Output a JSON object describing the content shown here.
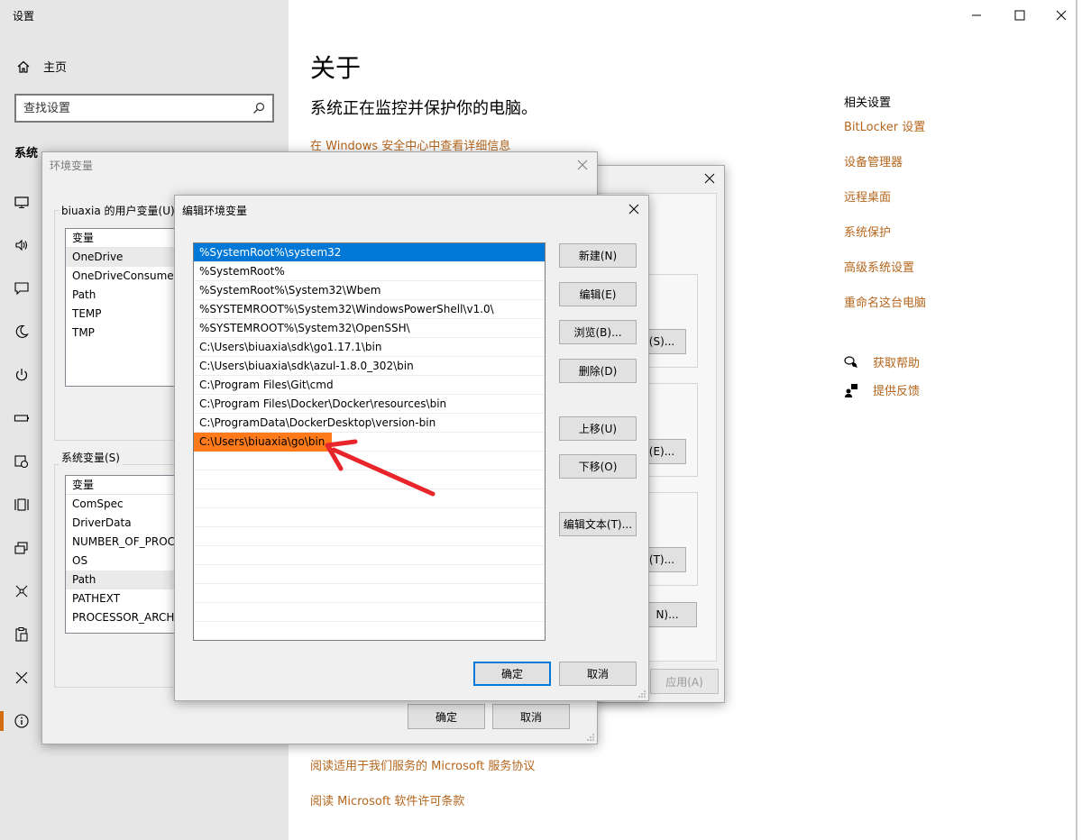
{
  "settings": {
    "app_title": "设置",
    "home_label": "主页",
    "search_placeholder": "查找设置",
    "section_label": "系统",
    "nav_icons": [
      "display-icon",
      "sound-icon",
      "notifications-icon",
      "focus-assist-icon",
      "power-icon",
      "battery-icon",
      "storage-icon",
      "tablet-icon",
      "multitasking-icon",
      "projecting-icon",
      "shared-experiences-icon",
      "clipboard-icon",
      "remote-desktop-icon",
      "about-icon"
    ]
  },
  "about": {
    "title": "关于",
    "subtitle": "系统正在监控并保护你的电脑。",
    "security_link": "在 Windows 安全中心中查看详细信息",
    "agreement_link": "阅读适用于我们服务的 Microsoft 服务协议",
    "license_link": "阅读 Microsoft 软件许可条款"
  },
  "related": {
    "title": "相关设置",
    "links": [
      "BitLocker 设置",
      "设备管理器",
      "远程桌面",
      "系统保护",
      "高级系统设置",
      "重命名这台电脑"
    ],
    "help": "获取帮助",
    "feedback": "提供反馈"
  },
  "env_dialog": {
    "title": "环境变量",
    "user_group": "biuaxia 的用户变量(U)",
    "user_header": "变量",
    "user_vars": [
      "OneDrive",
      "OneDriveConsumer",
      "Path",
      "TEMP",
      "TMP"
    ],
    "system_group": "系统变量(S)",
    "system_header": "变量",
    "system_vars": [
      "ComSpec",
      "DriverData",
      "NUMBER_OF_PROCE",
      "OS",
      "Path",
      "PATHEXT",
      "PROCESSOR_ARCHI"
    ],
    "ok": "确定",
    "cancel": "取消"
  },
  "sys_props": {
    "btn1": "(S)...",
    "btn2": "(E)...",
    "btn3": "(T)...",
    "btn4": "N)...",
    "apply": "应用(A)"
  },
  "edit_dialog": {
    "title": "编辑环境变量",
    "paths": [
      "%SystemRoot%\\system32",
      "%SystemRoot%",
      "%SystemRoot%\\System32\\Wbem",
      "%SYSTEMROOT%\\System32\\WindowsPowerShell\\v1.0\\",
      "%SYSTEMROOT%\\System32\\OpenSSH\\",
      "C:\\Users\\biuaxia\\sdk\\go1.17.1\\bin",
      "C:\\Users\\biuaxia\\sdk\\azul-1.8.0_302\\bin",
      "C:\\Program Files\\Git\\cmd",
      "C:\\Program Files\\Docker\\Docker\\resources\\bin",
      "C:\\ProgramData\\DockerDesktop\\version-bin"
    ],
    "highlighted_path": "C:\\Users\\biuaxia\\go\\bin",
    "buttons": {
      "new": "新建(N)",
      "edit": "编辑(E)",
      "browse": "浏览(B)...",
      "delete": "删除(D)",
      "move_up": "上移(U)",
      "move_down": "下移(O)",
      "edit_text": "编辑文本(T)..."
    },
    "ok": "确定",
    "cancel": "取消"
  },
  "colors": {
    "accent_link": "#b5651d",
    "selection_blue": "#0078d7",
    "highlight_orange": "#ff7a1a",
    "arrow_red": "#e8252a"
  }
}
